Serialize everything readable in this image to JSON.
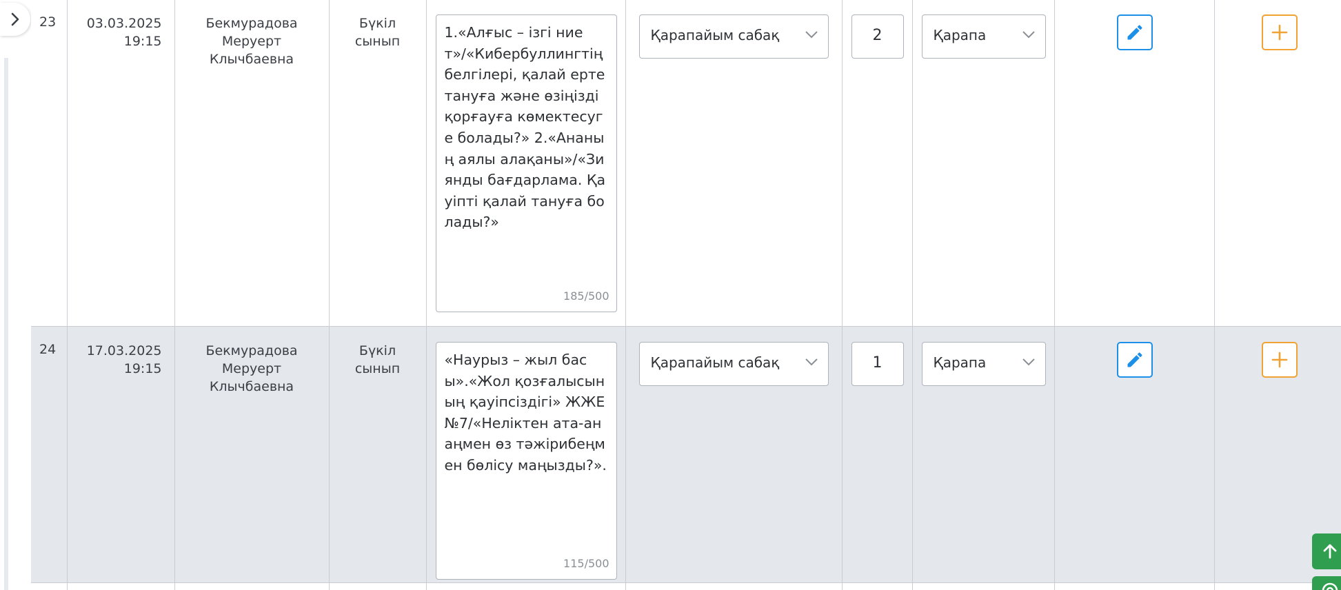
{
  "rows": [
    {
      "number": "23",
      "date": "03.03.2025",
      "time": "19:15",
      "teacher_line1": "Бекмурадова",
      "teacher_line2": "Меруерт",
      "teacher_line3": "Клычбаевна",
      "group_line1": "Бүкіл",
      "group_line2": "сынып",
      "topic": "1.«Алғыс – ізгі ниет»/«Кибербуллингтің белгілері, қалай ерте тануға және өзіңізді қорғауға көмектесуге болады?» 2.«Ананың аялы алақаны»/«Зиянды бағдарлама. Қауіпті қалай тануға болады?»",
      "topic_counter": "185/500",
      "lesson_type": "Қарапайым сабақ",
      "hours": "2",
      "type2": "Қарапа"
    },
    {
      "number": "24",
      "date": "17.03.2025",
      "time": "19:15",
      "teacher_line1": "Бекмурадова",
      "teacher_line2": "Меруерт",
      "teacher_line3": "Клычбаевна",
      "group_line1": "Бүкіл",
      "group_line2": "сынып",
      "topic": "«Наурыз – жыл басы».«Жол қозғалысының қауіпсіздігі» ЖЖЕ №7/«Неліктен ата-анаңмен өз тәжірибеңмен бөлісу маңызды?».",
      "topic_counter": "115/500",
      "lesson_type": "Қарапайым сабақ",
      "hours": "1",
      "type2": "Қарапа"
    }
  ],
  "icons": {
    "sidebar_toggle": "chevron-right-icon",
    "edit": "pencil-icon",
    "add": "plus-icon",
    "scroll_top": "arrow-up-icon",
    "help": "help-icon",
    "dropdown": "chevron-down-icon"
  },
  "colors": {
    "edit_accent": "#1c8fe8",
    "add_accent": "#f0a233",
    "scroll_button": "#2f9e4f",
    "alt_row_bg": "#e4e7ec"
  }
}
